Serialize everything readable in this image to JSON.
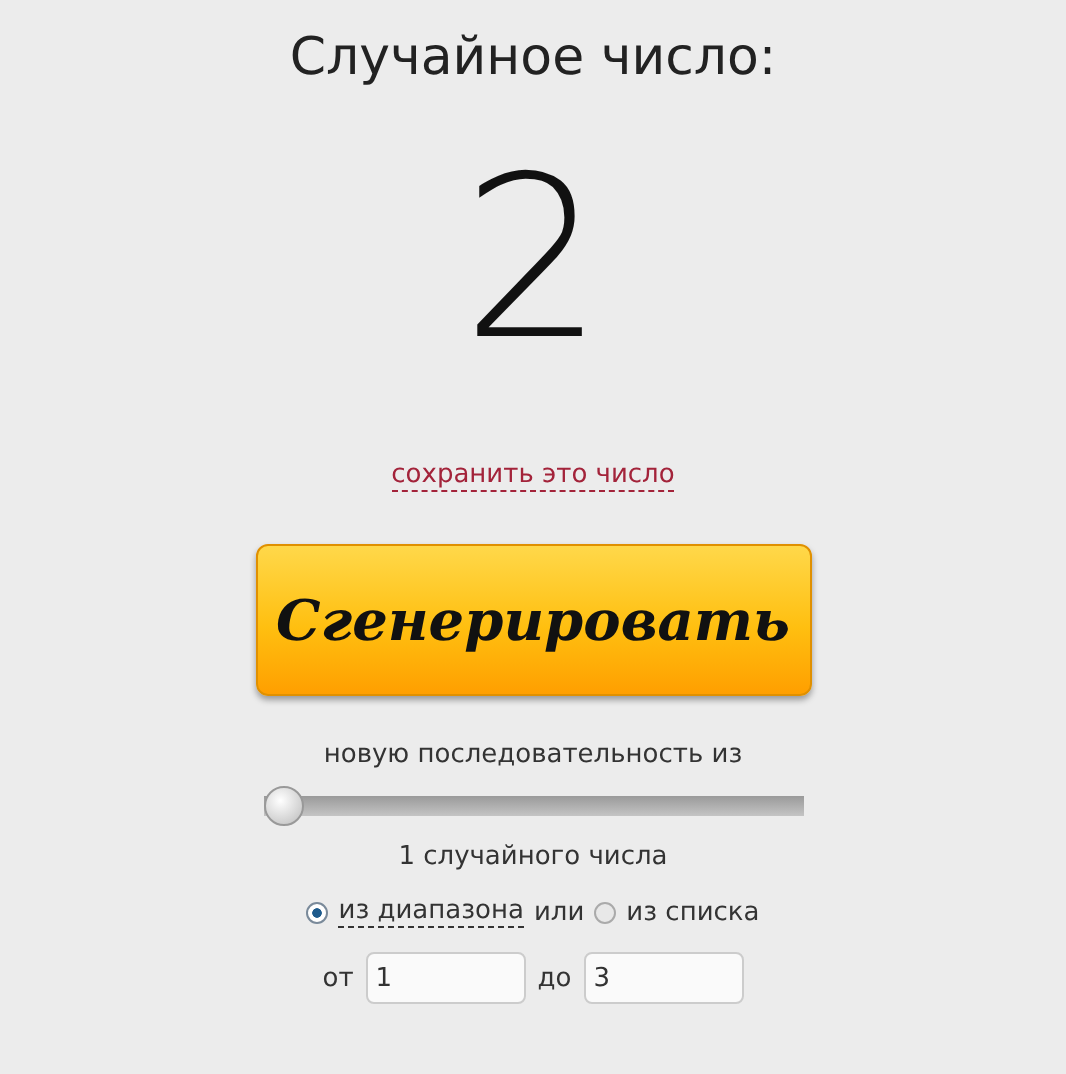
{
  "title": "Случайное число:",
  "result": "2",
  "save_link": "сохранить это число",
  "generate_button": "Сгенерировать",
  "sequence_label": "новую последовательность из",
  "count_slider": {
    "level": 0
  },
  "count_text": "1 случайного числа",
  "sources": [
    {
      "label": "из диапазона",
      "selected": true
    },
    {
      "label": "из списка",
      "selected": false
    }
  ],
  "sources_joiner": "или",
  "range": {
    "from_label": "от",
    "from_value": "1",
    "to_label": "до",
    "to_value": "3"
  }
}
